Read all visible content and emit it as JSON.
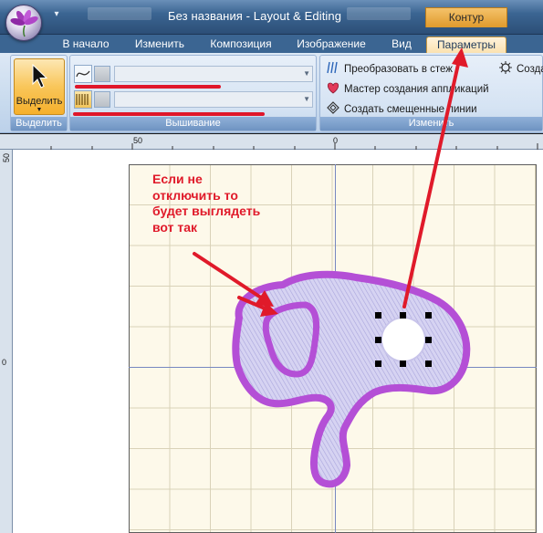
{
  "window": {
    "title": "Без названия - Layout & Editing",
    "context_tab_title": "Контур"
  },
  "tabs": [
    {
      "label": "В начало",
      "active": false
    },
    {
      "label": "Изменить",
      "active": false
    },
    {
      "label": "Композиция",
      "active": false
    },
    {
      "label": "Изображение",
      "active": false
    },
    {
      "label": "Вид",
      "active": false
    },
    {
      "label": "Параметры",
      "active": true
    }
  ],
  "ribbon": {
    "select_group": {
      "button_label": "Выделить",
      "group_label": "Выделить"
    },
    "embroidery_group": {
      "group_label": "Вышивание",
      "outline_type_value": "",
      "fill_type_value": ""
    },
    "modify_group": {
      "group_label": "Изменить",
      "commands": [
        {
          "label": "Преобразовать в стеж",
          "icon": "convert-stitch-icon"
        },
        {
          "label": "Мастер создания аппликаций",
          "icon": "applique-wizard-icon"
        },
        {
          "label": "Создать смещенные линии",
          "icon": "offset-lines-icon"
        }
      ],
      "extra_command": "Создат"
    }
  },
  "rulers": {
    "top_labels": [
      "50",
      "0"
    ],
    "left_labels": [
      "50",
      "0"
    ]
  },
  "annotation": {
    "text": "Если не отключить то будет выглядеть вот так",
    "color": "#e01a2a"
  },
  "colors": {
    "outline": "#b44fd6",
    "fill_stitch": "#c9c6ee",
    "hoop_background": "#fdf9ea",
    "accent_tab": "#f5b02c"
  }
}
